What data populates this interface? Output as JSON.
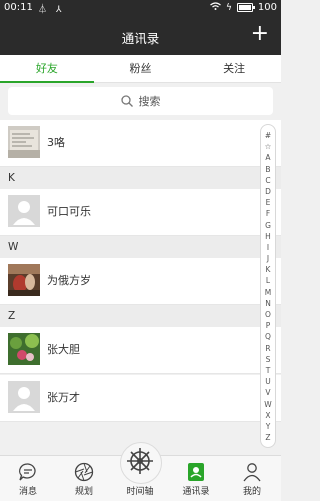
{
  "status": {
    "time": "00:11",
    "battery": "100",
    "battery_level": 1.0
  },
  "header": {
    "title": "通讯录",
    "add_icon": "plus-icon"
  },
  "tabs": [
    {
      "label": "好友",
      "active": true
    },
    {
      "label": "粉丝",
      "active": false
    },
    {
      "label": "关注",
      "active": false
    }
  ],
  "search": {
    "placeholder": "搜索",
    "icon": "search-icon"
  },
  "sections": {
    "k": "K",
    "w": "W",
    "z": "Z"
  },
  "contacts": [
    {
      "name": "3咯"
    },
    {
      "name": "可口可乐"
    },
    {
      "name": "为俄方岁"
    },
    {
      "name": "张大胆"
    },
    {
      "name": "张万才"
    }
  ],
  "index_letters": [
    "#",
    "☆",
    "A",
    "B",
    "C",
    "D",
    "E",
    "F",
    "G",
    "H",
    "I",
    "J",
    "K",
    "L",
    "M",
    "N",
    "O",
    "P",
    "Q",
    "R",
    "S",
    "T",
    "U",
    "V",
    "W",
    "X",
    "Y",
    "Z"
  ],
  "nav": [
    {
      "label": "消息",
      "icon": "message-icon"
    },
    {
      "label": "规划",
      "icon": "aperture-icon"
    },
    {
      "label": "时间轴",
      "icon": "timeline-wheel-icon"
    },
    {
      "label": "通讯录",
      "icon": "contacts-icon"
    },
    {
      "label": "我的",
      "icon": "profile-icon"
    }
  ],
  "colors": {
    "accent": "#2aa52a",
    "header": "#2b2b2b"
  }
}
